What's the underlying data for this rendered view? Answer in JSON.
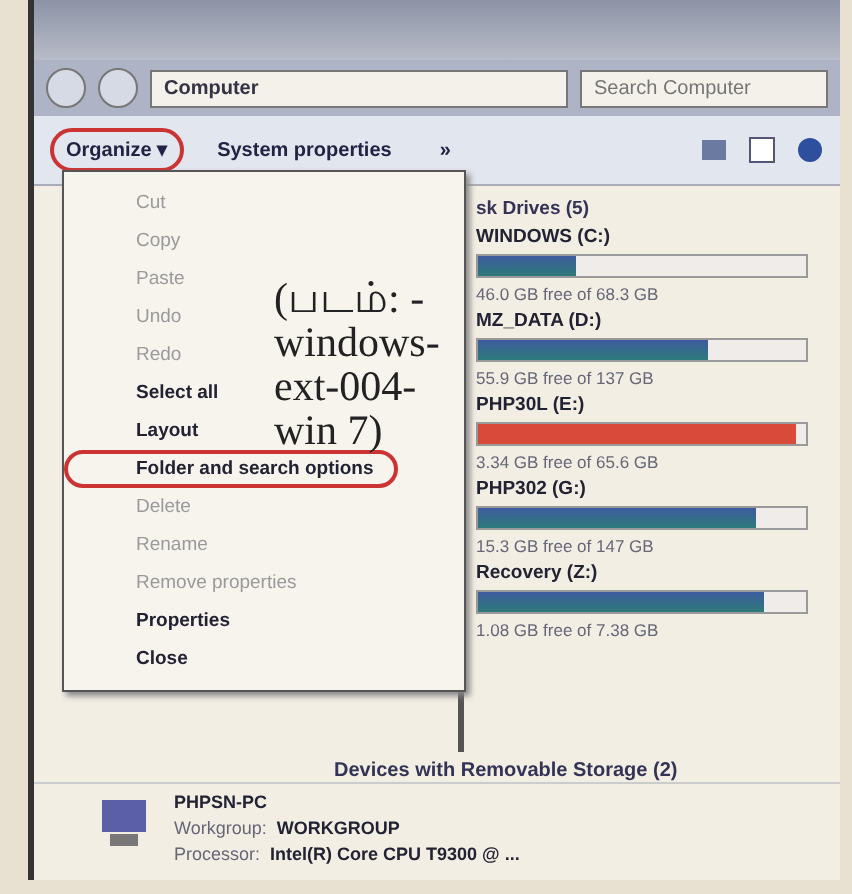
{
  "address_bar": {
    "path": "Computer",
    "search_placeholder": "Search Computer"
  },
  "toolbar": {
    "buttons": [
      {
        "label": "Organize",
        "caret": "▾",
        "annotated": true
      },
      {
        "label": "System properties",
        "annotated": false
      }
    ],
    "overflow": "»"
  },
  "menu": {
    "items": [
      {
        "label": "Cut",
        "disabled": true,
        "annotated": false
      },
      {
        "label": "Copy",
        "disabled": true,
        "annotated": false
      },
      {
        "label": "Paste",
        "disabled": true,
        "annotated": false
      },
      {
        "label": "Undo",
        "disabled": true,
        "annotated": false
      },
      {
        "label": "Redo",
        "disabled": true,
        "annotated": false
      },
      {
        "label": "Select all",
        "disabled": false,
        "annotated": false
      },
      {
        "label": "Layout",
        "disabled": false,
        "annotated": false
      },
      {
        "label": "Folder and search options",
        "disabled": false,
        "annotated": true
      },
      {
        "label": "Delete",
        "disabled": true,
        "annotated": false
      },
      {
        "label": "Rename",
        "disabled": true,
        "annotated": false
      },
      {
        "label": "Remove properties",
        "disabled": true,
        "annotated": false
      },
      {
        "label": "Properties",
        "disabled": false,
        "annotated": false
      },
      {
        "label": "Close",
        "disabled": false,
        "annotated": false
      }
    ]
  },
  "caption": "(படம்: -windows-ext-004-win 7)",
  "drives_group": "sk Drives (5)",
  "drives": [
    {
      "name": "WINDOWS (C:)",
      "level": 0.3,
      "free": "46.0 GB free of 68.3 GB",
      "full": false
    },
    {
      "name": "MZ_DATA (D:)",
      "level": 0.7,
      "free": "55.9 GB free of 137 GB",
      "full": false
    },
    {
      "name": "PHP30L (E:)",
      "level": 0.97,
      "free": "3.34 GB free of 65.6 GB",
      "full": true
    },
    {
      "name": "PHP302 (G:)",
      "level": 0.85,
      "free": "15.3 GB free of 147 GB",
      "full": false
    },
    {
      "name": "Recovery (Z:)",
      "level": 0.87,
      "free": "1.08 GB free of 7.38 GB",
      "full": false
    }
  ],
  "removable_group": "Devices with Removable Storage (2)",
  "details": {
    "computer": "PHPSN-PC",
    "rows": [
      {
        "label": "Workgroup:",
        "value": "WORKGROUP"
      },
      {
        "label": "Processor:",
        "value": "Intel(R) Core CPU T9300 @ ..."
      }
    ]
  }
}
